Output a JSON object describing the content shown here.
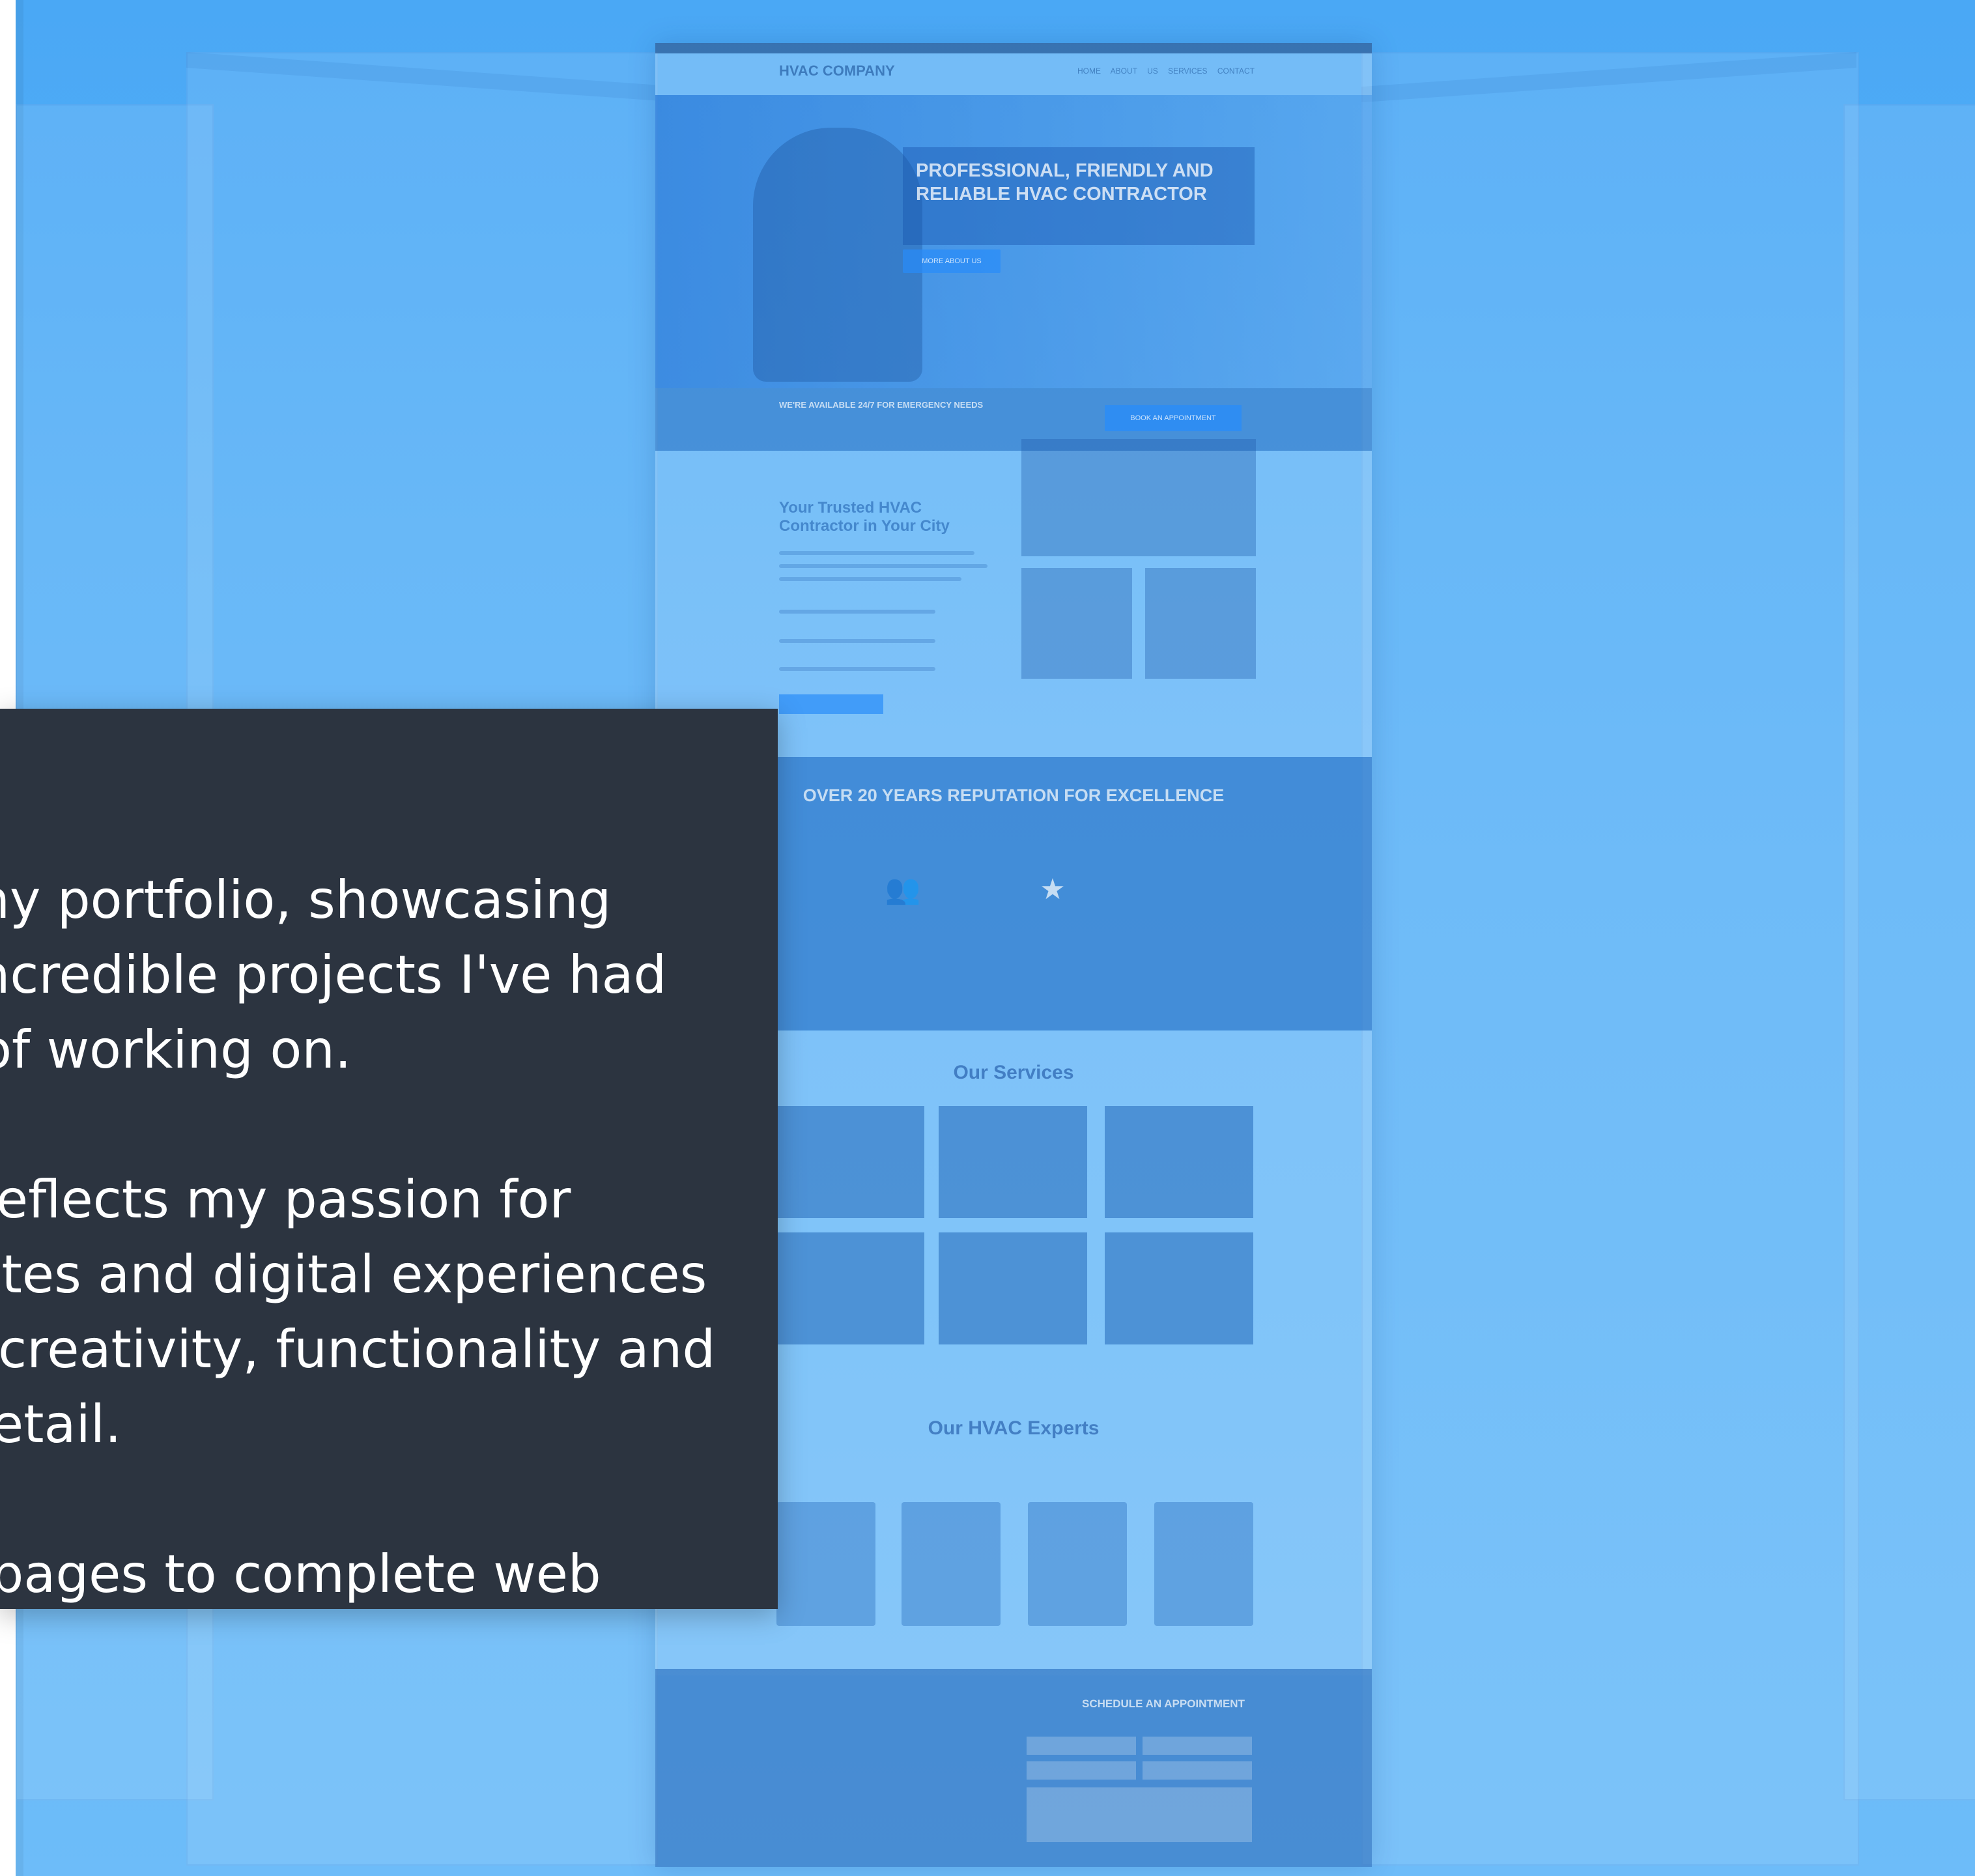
{
  "intro": {
    "paragraphs": [
      "Welcome to my portfolio, showcasing some of the incredible projects I've had the privilege of working on.",
      "Each project reflects my passion for crafting websites and digital experiences that combine creativity, functionality and attention to detail.",
      "From landing pages to complete web design solutions, my work is focused on delivering impactful online experiences."
    ]
  },
  "showcase": {
    "logo": "HVAC COMPANY",
    "nav": "HOME  ABOUT US  SERVICES  CONTACT",
    "hero_headline": "Professional, Friendly and Reliable HVAC Contractor",
    "hero_button": "MORE ABOUT US",
    "strip_headline": "We're available 24/7 for emergency needs",
    "strip_button": "BOOK AN APPOINTMENT",
    "about_heading": "Your Trusted HVAC Contractor in Your City",
    "reputation_heading": "Over 20 Years Reputation for Excellence",
    "services_heading": "Our Services",
    "experts_heading": "Our HVAC Experts",
    "appointment_heading": "Schedule an Appointment",
    "icons": [
      "gift-icon",
      "people-icon",
      "star-icon"
    ]
  },
  "colors": {
    "background_blue": "#5cb3f8",
    "panel_dark": "#2c3440",
    "panel_text": "#ffffff"
  }
}
